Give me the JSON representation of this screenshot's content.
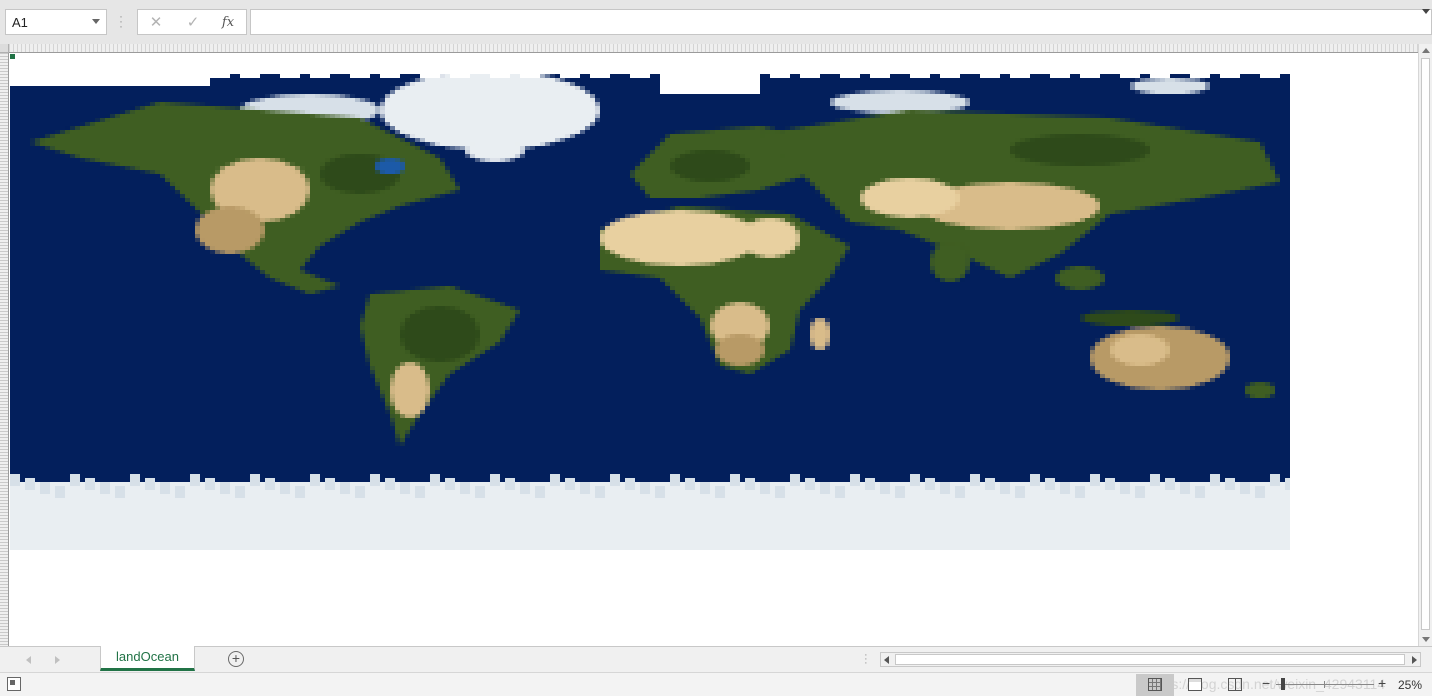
{
  "formula_bar": {
    "name_box": "A1",
    "cancel_icon": "✕",
    "enter_icon": "✓",
    "insert_function": "fx",
    "formula_value": ""
  },
  "sheet": {
    "tab_label": "landOcean",
    "add_sheet_icon": "+"
  },
  "status_bar": {
    "zoom_level": "25%",
    "watermark": "https://blog.csdn.net/weixin_42943114"
  },
  "icons": [
    "dropdown-caret-icon",
    "cancel-icon",
    "enter-icon",
    "insert-function-icon",
    "add-sheet-icon",
    "macro-record-icon",
    "normal-view-icon",
    "page-layout-view-icon",
    "page-break-view-icon"
  ],
  "colors": {
    "accent": "#217346",
    "ocean": "#031f5c",
    "ice": "#e9eef2"
  }
}
